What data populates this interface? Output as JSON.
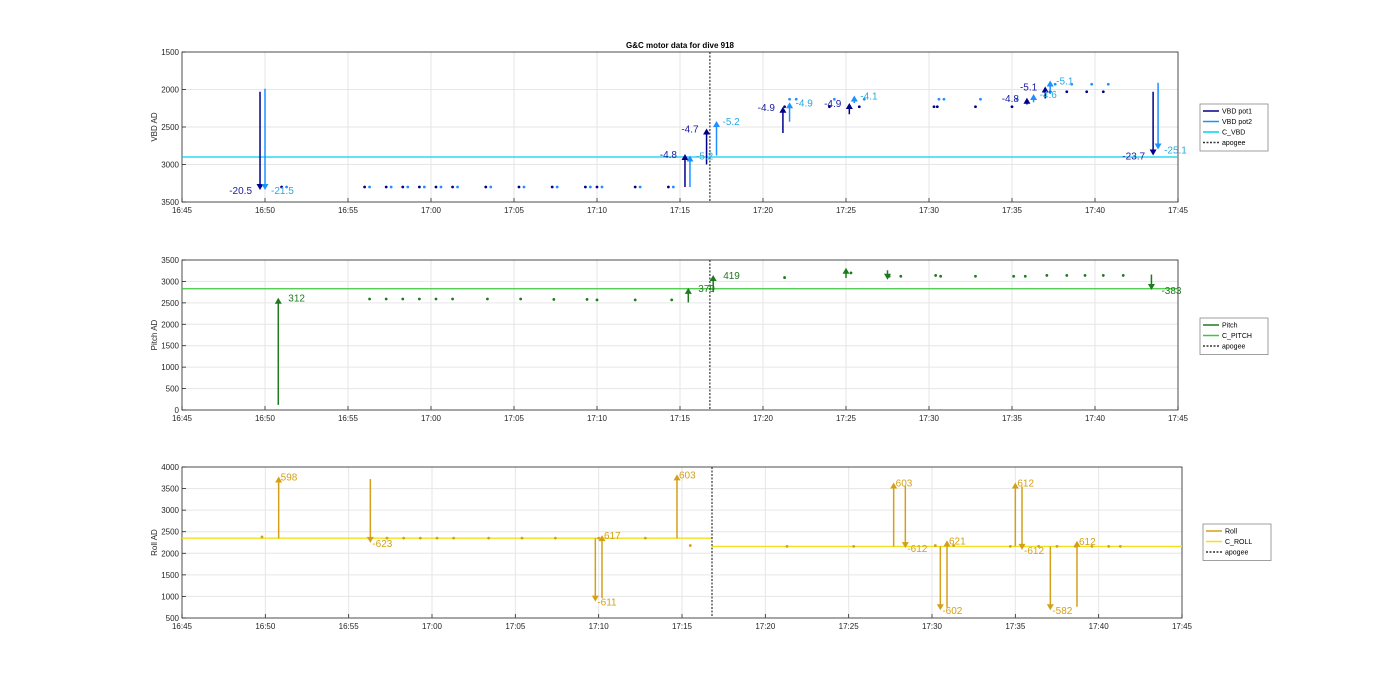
{
  "figure": {
    "title": "G&C motor data for dive 918"
  },
  "colors": {
    "vbd_pot1": "#00008b",
    "vbd_pot2": "#1e90ff",
    "c_vbd": "#00d2ee",
    "pitch": "#1e7a1e",
    "c_pitch": "#3cc83c",
    "roll": "#d4a017",
    "c_roll": "#f0e020",
    "apogee": "#333333",
    "grid": "#e6e6e6",
    "axis": "#262626"
  },
  "chart_data": [
    {
      "id": "vbd",
      "type": "line",
      "ylabel": "VBD AD",
      "xlabel": "",
      "x_ticks": [
        "16:45",
        "16:50",
        "16:55",
        "17:00",
        "17:05",
        "17:10",
        "17:15",
        "17:20",
        "17:25",
        "17:30",
        "17:35",
        "17:40",
        "17:45"
      ],
      "xlim_min": [
        0,
        60
      ],
      "ylim": [
        1500,
        3500
      ],
      "y_reversed": true,
      "y_ticks": [
        1500,
        2000,
        2500,
        3000,
        3500
      ],
      "grid": true,
      "legend": {
        "placement": "right",
        "entries": [
          "VBD pot1",
          "VBD pot2",
          "C_VBD",
          "apogee"
        ]
      },
      "apogee_min": 31.8,
      "command_level": 2900,
      "command_segments": [
        [
          0,
          60,
          2900
        ]
      ],
      "pot1_points": [
        [
          6.0,
          3300
        ],
        [
          11.0,
          3300
        ],
        [
          12.3,
          3300
        ],
        [
          13.3,
          3300
        ],
        [
          14.3,
          3300
        ],
        [
          15.3,
          3300
        ],
        [
          16.3,
          3300
        ],
        [
          18.3,
          3300
        ],
        [
          20.3,
          3300
        ],
        [
          22.3,
          3300
        ],
        [
          24.3,
          3300
        ],
        [
          25.0,
          3300
        ],
        [
          27.3,
          3300
        ],
        [
          29.3,
          3300
        ],
        [
          36.3,
          2230
        ],
        [
          39.0,
          2230
        ],
        [
          40.8,
          2230
        ],
        [
          45.3,
          2230
        ],
        [
          45.5,
          2230
        ],
        [
          47.8,
          2230
        ],
        [
          50.0,
          2230
        ],
        [
          52.3,
          2030
        ],
        [
          53.3,
          2030
        ],
        [
          54.5,
          2030
        ],
        [
          55.5,
          2030
        ]
      ],
      "pot2_points": [
        [
          6.3,
          3300
        ],
        [
          11.3,
          3300
        ],
        [
          12.6,
          3300
        ],
        [
          13.6,
          3300
        ],
        [
          14.6,
          3300
        ],
        [
          15.6,
          3300
        ],
        [
          16.6,
          3300
        ],
        [
          18.6,
          3300
        ],
        [
          20.6,
          3300
        ],
        [
          22.6,
          3300
        ],
        [
          24.6,
          3300
        ],
        [
          25.3,
          3300
        ],
        [
          27.6,
          3300
        ],
        [
          29.6,
          3300
        ],
        [
          36.6,
          2130
        ],
        [
          37.0,
          2130
        ],
        [
          39.3,
          2130
        ],
        [
          41.1,
          2130
        ],
        [
          45.6,
          2130
        ],
        [
          45.9,
          2130
        ],
        [
          48.1,
          2130
        ],
        [
          50.3,
          2130
        ],
        [
          52.6,
          1930
        ],
        [
          53.6,
          1930
        ],
        [
          54.8,
          1930
        ],
        [
          55.8,
          1930
        ]
      ],
      "pot1_arrows": [
        {
          "t": 4.7,
          "from": 2030,
          "to": 3340,
          "label": "-20.5"
        },
        {
          "t": 30.3,
          "from": 3300,
          "to": 2860,
          "label": "-4.8"
        },
        {
          "t": 31.6,
          "from": 3000,
          "to": 2520,
          "label": "-4.7"
        },
        {
          "t": 36.2,
          "from": 2580,
          "to": 2230,
          "label": "-4.9"
        },
        {
          "t": 40.2,
          "from": 2330,
          "to": 2180,
          "label": "-4.9"
        },
        {
          "t": 50.9,
          "from": 2200,
          "to": 2110,
          "label": "-4.8"
        },
        {
          "t": 52.0,
          "from": 2120,
          "to": 1960,
          "label": "-5.1"
        },
        {
          "t": 58.5,
          "from": 2030,
          "to": 2880,
          "label": "-23.7"
        }
      ],
      "pot2_arrows": [
        {
          "t": 5.0,
          "from": 1990,
          "to": 3340,
          "label": "-21.5"
        },
        {
          "t": 30.6,
          "from": 3300,
          "to": 2880,
          "label": "-5.2"
        },
        {
          "t": 32.2,
          "from": 2880,
          "to": 2420,
          "label": "-5.2"
        },
        {
          "t": 36.6,
          "from": 2430,
          "to": 2170,
          "label": "-4.9"
        },
        {
          "t": 40.5,
          "from": 2180,
          "to": 2080,
          "label": "-4.1"
        },
        {
          "t": 51.3,
          "from": 2170,
          "to": 2060,
          "label": "-4.6"
        },
        {
          "t": 52.3,
          "from": 2060,
          "to": 1880,
          "label": "-5.1"
        },
        {
          "t": 58.8,
          "from": 1910,
          "to": 2800,
          "label": "-25.1"
        }
      ]
    },
    {
      "id": "pitch",
      "type": "line",
      "ylabel": "Pitch AD",
      "xlabel": "",
      "x_ticks": [
        "16:45",
        "16:50",
        "16:55",
        "17:00",
        "17:05",
        "17:10",
        "17:15",
        "17:20",
        "17:25",
        "17:30",
        "17:35",
        "17:40",
        "17:45"
      ],
      "xlim_min": [
        0,
        60
      ],
      "ylim": [
        0,
        3500
      ],
      "y_reversed": false,
      "y_ticks": [
        0,
        500,
        1000,
        1500,
        2000,
        2500,
        3000,
        3500
      ],
      "grid": true,
      "legend": {
        "placement": "right",
        "entries": [
          "Pitch",
          "C_PITCH",
          "apogee"
        ]
      },
      "apogee_min": 31.8,
      "command_level": 2830,
      "command_segments": [
        [
          0,
          60,
          2830
        ]
      ],
      "points": [
        [
          11.3,
          2590
        ],
        [
          12.3,
          2590
        ],
        [
          13.3,
          2590
        ],
        [
          14.3,
          2590
        ],
        [
          15.3,
          2590
        ],
        [
          16.3,
          2590
        ],
        [
          18.4,
          2590
        ],
        [
          20.4,
          2590
        ],
        [
          22.4,
          2580
        ],
        [
          24.4,
          2580
        ],
        [
          25.0,
          2570
        ],
        [
          27.3,
          2570
        ],
        [
          29.5,
          2570
        ],
        [
          36.3,
          3090
        ],
        [
          40.3,
          3200
        ],
        [
          42.6,
          3120
        ],
        [
          43.3,
          3120
        ],
        [
          45.4,
          3140
        ],
        [
          45.7,
          3120
        ],
        [
          47.8,
          3120
        ],
        [
          50.1,
          3120
        ],
        [
          50.8,
          3120
        ],
        [
          52.1,
          3140
        ],
        [
          53.3,
          3140
        ],
        [
          54.4,
          3140
        ],
        [
          55.5,
          3140
        ],
        [
          56.7,
          3140
        ]
      ],
      "arrows": [
        {
          "t": 5.8,
          "from": 120,
          "to": 2620,
          "label": "312"
        },
        {
          "t": 30.5,
          "from": 2510,
          "to": 2850,
          "label": "379"
        },
        {
          "t": 32.0,
          "from": 2750,
          "to": 3150,
          "label": "419"
        },
        {
          "t": 40.0,
          "from": 3080,
          "to": 3320,
          "label": ""
        },
        {
          "t": 42.5,
          "from": 3260,
          "to": 3040,
          "label": ""
        },
        {
          "t": 58.4,
          "from": 3160,
          "to": 2800,
          "label": "-383"
        }
      ]
    },
    {
      "id": "roll",
      "type": "line",
      "ylabel": "Roll AD",
      "xlabel": "",
      "x_ticks": [
        "16:45",
        "16:50",
        "16:55",
        "17:00",
        "17:05",
        "17:10",
        "17:15",
        "17:20",
        "17:25",
        "17:30",
        "17:35",
        "17:40",
        "17:45"
      ],
      "xlim_min": [
        0,
        60
      ],
      "ylim": [
        500,
        4000
      ],
      "y_reversed": false,
      "y_ticks": [
        500,
        1000,
        1500,
        2000,
        2500,
        3000,
        3500,
        4000
      ],
      "grid": true,
      "legend": {
        "placement": "right",
        "entries": [
          "Roll",
          "C_ROLL",
          "apogee"
        ]
      },
      "apogee_min": 31.8,
      "command_segments": [
        [
          0,
          31.8,
          2350
        ],
        [
          31.8,
          60,
          2160
        ]
      ],
      "points": [
        [
          4.8,
          2380
        ],
        [
          11.3,
          2350
        ],
        [
          12.3,
          2350
        ],
        [
          13.3,
          2350
        ],
        [
          14.3,
          2350
        ],
        [
          15.3,
          2350
        ],
        [
          16.3,
          2350
        ],
        [
          18.4,
          2350
        ],
        [
          20.4,
          2350
        ],
        [
          22.4,
          2350
        ],
        [
          25.0,
          2350
        ],
        [
          27.8,
          2350
        ],
        [
          30.5,
          2180
        ],
        [
          36.3,
          2160
        ],
        [
          40.3,
          2160
        ],
        [
          45.2,
          2180
        ],
        [
          46.3,
          2180
        ],
        [
          49.7,
          2160
        ],
        [
          51.4,
          2160
        ],
        [
          52.5,
          2160
        ],
        [
          53.6,
          2160
        ],
        [
          54.6,
          2160
        ],
        [
          55.6,
          2160
        ],
        [
          56.3,
          2160
        ]
      ],
      "arrows": [
        {
          "t": 5.8,
          "from": 2350,
          "to": 3780,
          "label": "598"
        },
        {
          "t": 11.3,
          "from": 3720,
          "to": 2240,
          "label": "-623"
        },
        {
          "t": 24.8,
          "from": 2350,
          "to": 880,
          "label": "-611"
        },
        {
          "t": 25.2,
          "from": 960,
          "to": 2420,
          "label": "617"
        },
        {
          "t": 29.7,
          "from": 2350,
          "to": 3830,
          "label": "603"
        },
        {
          "t": 42.7,
          "from": 2160,
          "to": 3640,
          "label": "603"
        },
        {
          "t": 43.4,
          "from": 3560,
          "to": 2120,
          "label": "-612"
        },
        {
          "t": 45.5,
          "from": 2160,
          "to": 680,
          "label": "-602"
        },
        {
          "t": 45.9,
          "from": 740,
          "to": 2300,
          "label": "621"
        },
        {
          "t": 50.0,
          "from": 2160,
          "to": 3640,
          "label": "612"
        },
        {
          "t": 50.4,
          "from": 3550,
          "to": 2080,
          "label": "-612"
        },
        {
          "t": 52.1,
          "from": 2160,
          "to": 680,
          "label": "-582"
        },
        {
          "t": 53.7,
          "from": 760,
          "to": 2290,
          "label": "612"
        }
      ]
    }
  ]
}
